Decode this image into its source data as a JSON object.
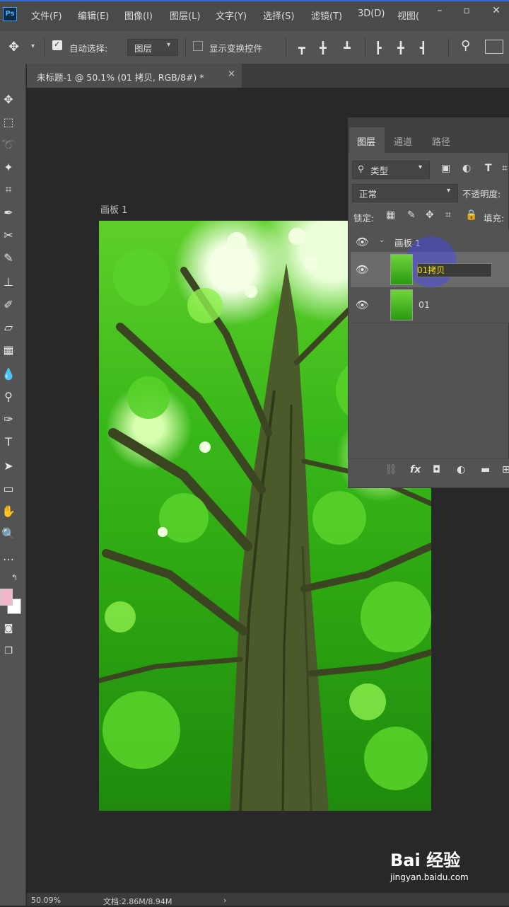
{
  "app": {
    "logo": "Ps"
  },
  "menu": [
    "文件(F)",
    "编辑(E)",
    "图像(I)",
    "图层(L)",
    "文字(Y)",
    "选择(S)",
    "滤镜(T)",
    "3D(D)",
    "视图("
  ],
  "options": {
    "auto_select_label": "自动选择:",
    "auto_select_value": "图层",
    "show_transform_label": "显示变换控件"
  },
  "document_tab": {
    "label": "未标题-1 @ 50.1% (01 拷贝, RGB/8#) *",
    "close": "×"
  },
  "artboard": {
    "label": "画板 1"
  },
  "layers_panel": {
    "tabs": [
      "图层",
      "通道",
      "路径"
    ],
    "filter_label": "类型",
    "blend_mode": "正常",
    "opacity_label": "不透明度:",
    "lock_label": "锁定:",
    "fill_label": "填充:",
    "group_name": "画板 1",
    "layers": [
      {
        "name": "01拷贝",
        "selected": true,
        "editing": true
      },
      {
        "name": "01",
        "selected": false
      }
    ]
  },
  "status": {
    "zoom": "50.09%",
    "doc_size": "文档:2.86M/8.94M"
  },
  "colors": {
    "foreground": "#f0b8c8",
    "background": "#ffffff",
    "accent": "#2f6bd6"
  },
  "watermark": {
    "brand": "Bai 经验",
    "url": "jingyan.baidu.com"
  }
}
